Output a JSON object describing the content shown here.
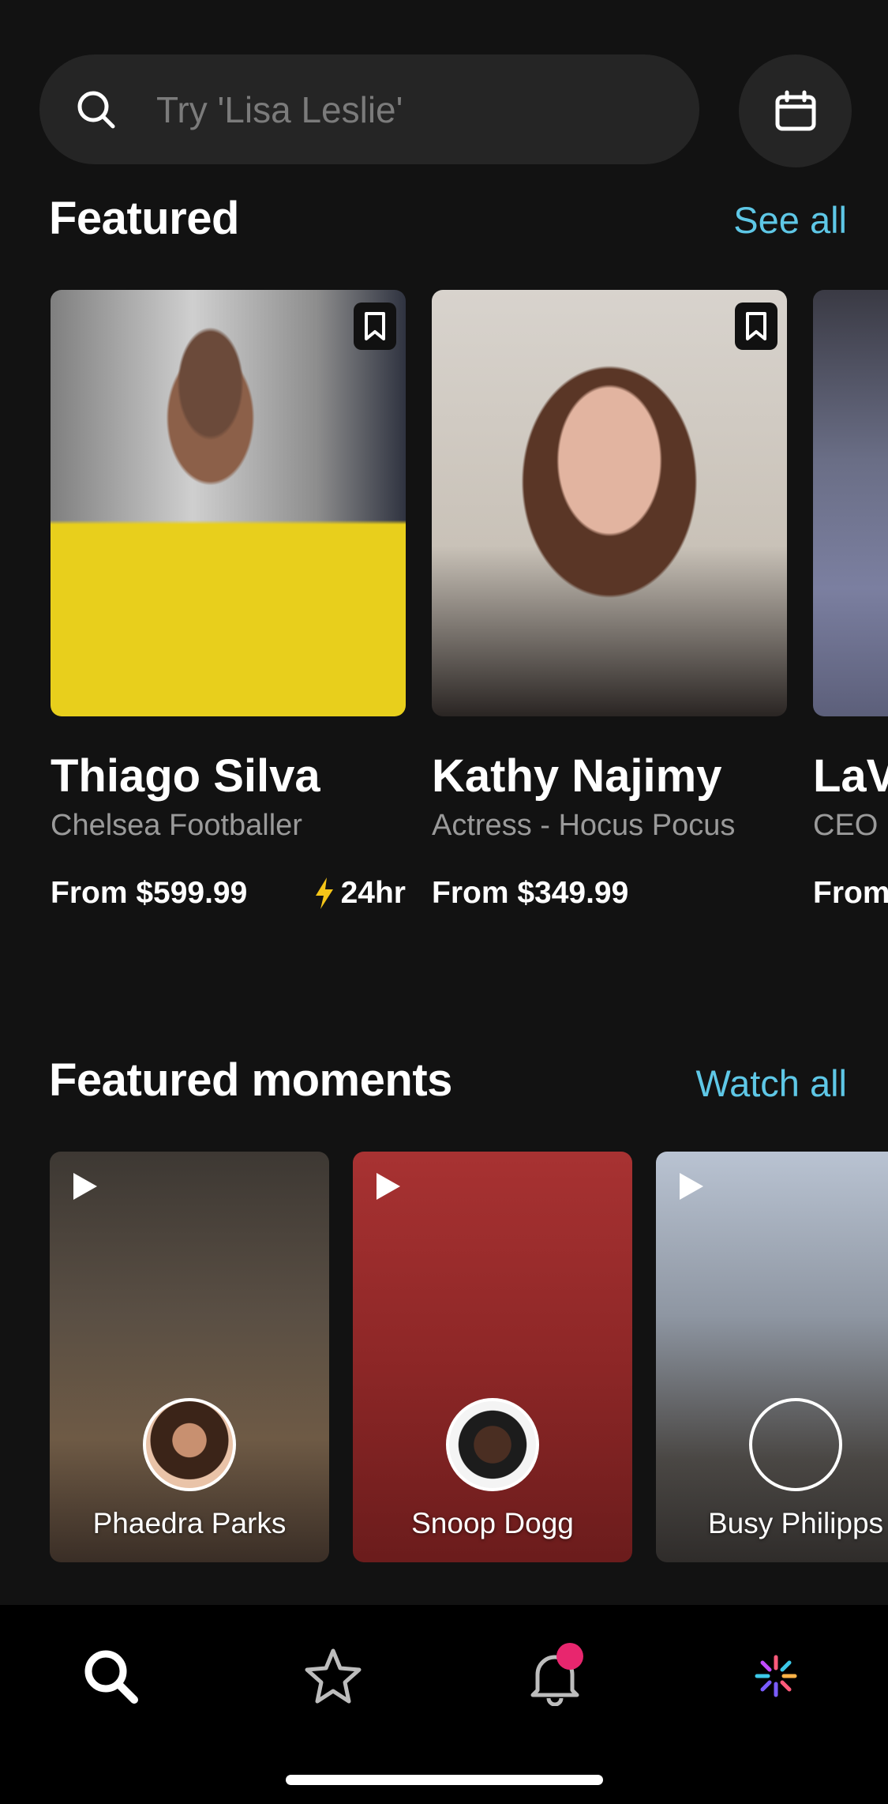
{
  "search": {
    "placeholder": "Try 'Lisa Leslie'"
  },
  "featured": {
    "title": "Featured",
    "see_all": "See all",
    "cards": [
      {
        "name": "Thiago Silva",
        "subtitle": "Chelsea Footballer",
        "price": "From $599.99",
        "fast": "24hr"
      },
      {
        "name": "Kathy Najimy",
        "subtitle": "Actress - Hocus Pocus",
        "price": "From $349.99"
      },
      {
        "name": "LaV",
        "subtitle": "CEO",
        "price": "From"
      }
    ]
  },
  "moments": {
    "title": "Featured moments",
    "watch_all": "Watch all",
    "cards": [
      {
        "name": "Phaedra Parks"
      },
      {
        "name": "Snoop Dogg"
      },
      {
        "name": "Busy Philipps"
      }
    ]
  },
  "nav": {
    "items": [
      "search-icon",
      "star-icon",
      "bell-icon",
      "sparkle-icon"
    ],
    "notification_badge": true
  },
  "colors": {
    "accent": "#5ec7e6",
    "badge": "#e8266e",
    "bolt": "#f5c518",
    "background": "#121212"
  }
}
